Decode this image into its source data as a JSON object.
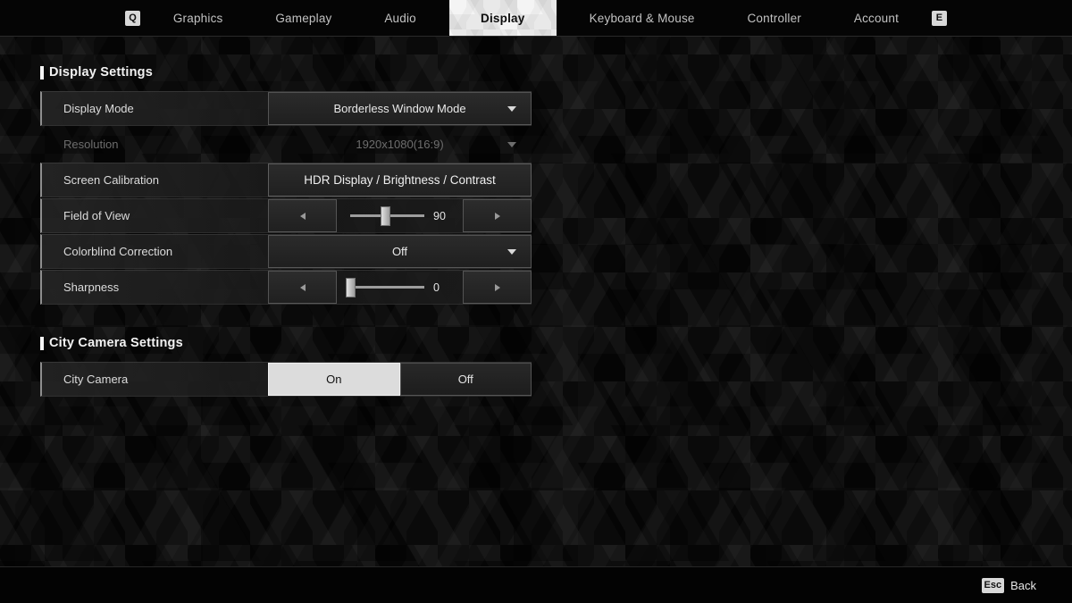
{
  "nav": {
    "prev_key": "Q",
    "next_key": "E",
    "tabs": [
      {
        "label": "Graphics",
        "active": false
      },
      {
        "label": "Gameplay",
        "active": false
      },
      {
        "label": "Audio",
        "active": false
      },
      {
        "label": "Display",
        "active": true
      },
      {
        "label": "Keyboard & Mouse",
        "active": false
      },
      {
        "label": "Controller",
        "active": false
      },
      {
        "label": "Account",
        "active": false
      }
    ]
  },
  "display_settings": {
    "title": "Display Settings",
    "rows": {
      "display_mode": {
        "label": "Display Mode",
        "value": "Borderless Window Mode"
      },
      "resolution": {
        "label": "Resolution",
        "value": "1920x1080(16:9)"
      },
      "screen_calibration": {
        "label": "Screen Calibration",
        "value": "HDR Display / Brightness / Contrast"
      },
      "field_of_view": {
        "label": "Field of View",
        "value": "90"
      },
      "colorblind_correction": {
        "label": "Colorblind Correction",
        "value": "Off"
      },
      "sharpness": {
        "label": "Sharpness",
        "value": "0"
      }
    }
  },
  "city_camera_settings": {
    "title": "City Camera Settings",
    "rows": {
      "city_camera": {
        "label": "City Camera",
        "option_on": "On",
        "option_off": "Off",
        "selected": "On"
      }
    }
  },
  "footer": {
    "back_key": "Esc",
    "back_label": "Back"
  },
  "colors": {
    "background": "#0a0a0a",
    "accent_bar": "#f5f5f5",
    "active_tab_bg": "#e9e9e9",
    "selected_toggle_bg": "#dcdcdc",
    "text_primary": "#e6e6e6",
    "text_disabled": "#6d6d6d"
  }
}
